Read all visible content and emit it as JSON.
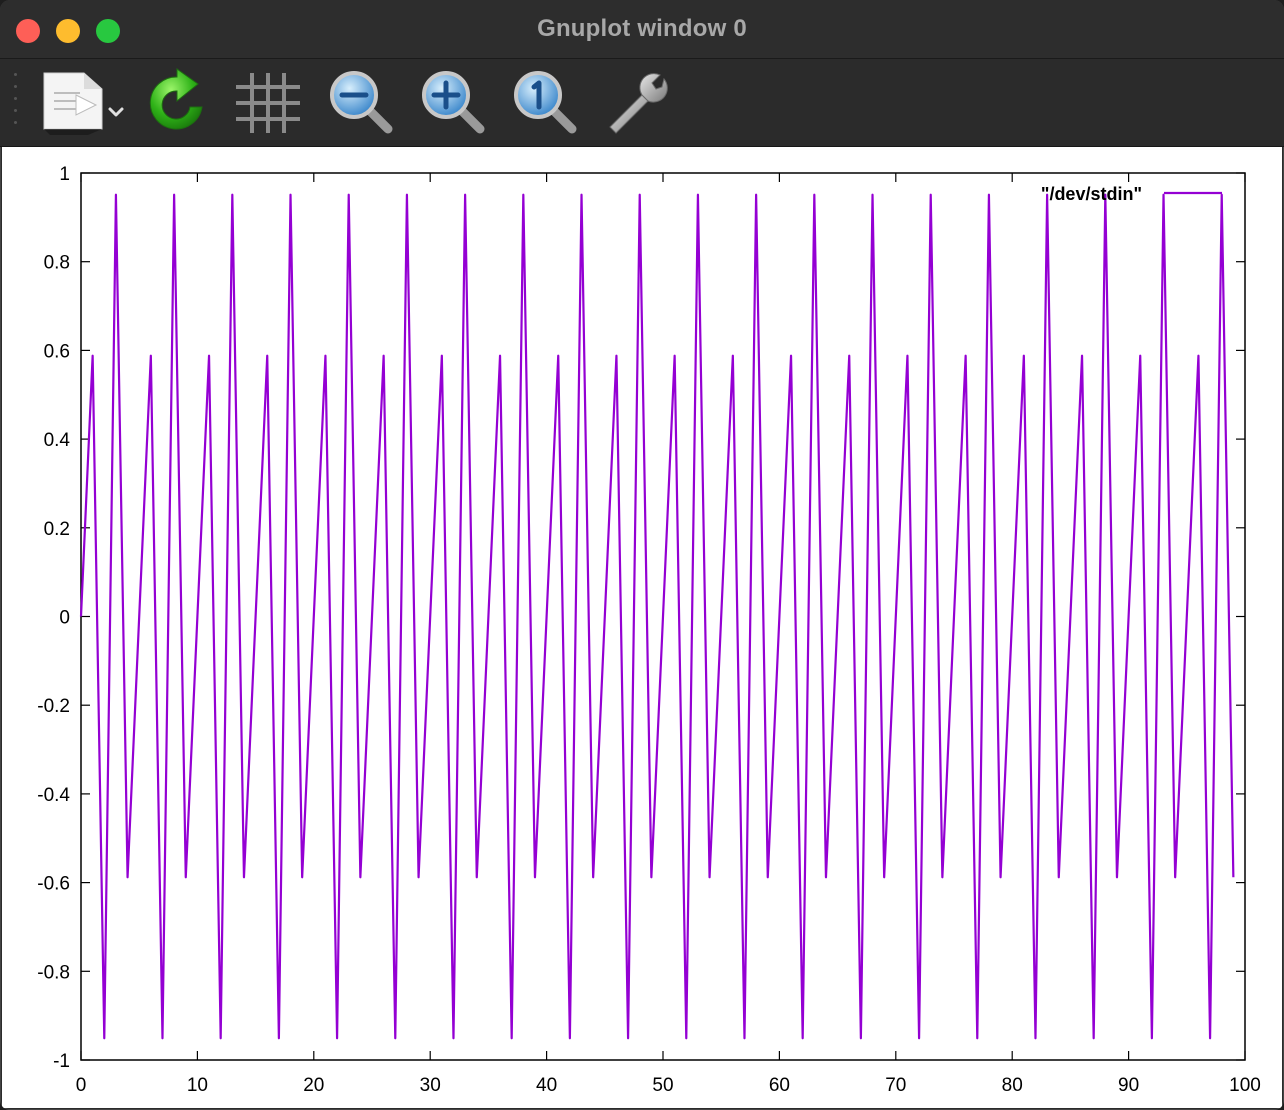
{
  "window": {
    "title": "Gnuplot window 0"
  },
  "toolbar": {
    "items": [
      {
        "name": "export",
        "icon": "export-document-icon"
      },
      {
        "name": "replot",
        "icon": "replot-icon"
      },
      {
        "name": "grid",
        "icon": "grid-icon"
      },
      {
        "name": "zoom-previous",
        "icon": "zoom-previous-icon"
      },
      {
        "name": "zoom-next",
        "icon": "zoom-next-icon"
      },
      {
        "name": "autoscale",
        "icon": "autoscale-icon"
      },
      {
        "name": "settings",
        "icon": "wrench-icon"
      }
    ]
  },
  "chart_data": {
    "type": "line",
    "legend": "\"/dev/stdin\"",
    "legend_position": "top-right",
    "xlim": [
      0,
      100
    ],
    "ylim": [
      -1,
      1
    ],
    "x_ticks": [
      "0",
      "10",
      "20",
      "30",
      "40",
      "50",
      "60",
      "70",
      "80",
      "90",
      "100"
    ],
    "y_ticks": [
      "1",
      "0.8",
      "0.6",
      "0.4",
      "0.2",
      "0",
      "-0.2",
      "-0.4",
      "-0.6",
      "-0.8",
      "-1"
    ],
    "grid": false,
    "color": "#9400d3",
    "series": [
      {
        "name": "\"/dev/stdin\"",
        "x": [
          0,
          1,
          2,
          3,
          4,
          5,
          6,
          7,
          8,
          9,
          10,
          11,
          12,
          13,
          14,
          15,
          16,
          17,
          18,
          19,
          20,
          21,
          22,
          23,
          24,
          25,
          26,
          27,
          28,
          29,
          30,
          31,
          32,
          33,
          34,
          35,
          36,
          37,
          38,
          39,
          40,
          41,
          42,
          43,
          44,
          45,
          46,
          47,
          48,
          49,
          50,
          51,
          52,
          53,
          54,
          55,
          56,
          57,
          58,
          59,
          60,
          61,
          62,
          63,
          64,
          65,
          66,
          67,
          68,
          69,
          70,
          71,
          72,
          73,
          74,
          75,
          76,
          77,
          78,
          79,
          80,
          81,
          82,
          83,
          84,
          85,
          86,
          87,
          88,
          89,
          90,
          91,
          92,
          93,
          94,
          95,
          96,
          97,
          98,
          99
        ],
        "y": [
          0,
          0.588,
          -0.951,
          0.951,
          -0.588,
          0,
          0.588,
          -0.951,
          0.951,
          -0.588,
          0,
          0.588,
          -0.951,
          0.951,
          -0.588,
          0,
          0.588,
          -0.951,
          0.951,
          -0.588,
          0,
          0.588,
          -0.951,
          0.951,
          -0.588,
          0,
          0.588,
          -0.951,
          0.951,
          -0.588,
          0,
          0.588,
          -0.951,
          0.951,
          -0.588,
          0,
          0.588,
          -0.951,
          0.951,
          -0.588,
          0,
          0.588,
          -0.951,
          0.951,
          -0.588,
          0,
          0.588,
          -0.951,
          0.951,
          -0.588,
          0,
          0.588,
          -0.951,
          0.951,
          -0.588,
          0,
          0.588,
          -0.951,
          0.951,
          -0.588,
          0,
          0.588,
          -0.951,
          0.951,
          -0.588,
          0,
          0.588,
          -0.951,
          0.951,
          -0.588,
          0,
          0.588,
          -0.951,
          0.951,
          -0.588,
          0,
          0.588,
          -0.951,
          0.951,
          -0.588,
          0,
          0.588,
          -0.951,
          0.951,
          -0.588,
          0,
          0.588,
          -0.951,
          0.951,
          -0.588,
          0,
          0.588,
          -0.951,
          0.951,
          -0.588,
          0,
          0.588,
          -0.951,
          0.951,
          -0.588
        ]
      }
    ]
  }
}
